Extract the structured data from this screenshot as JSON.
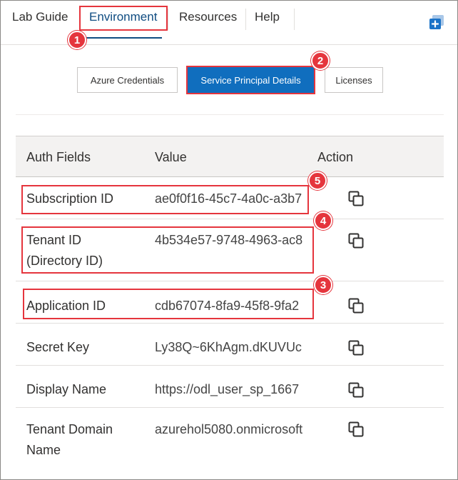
{
  "nav": {
    "tabs": [
      {
        "label": "Lab Guide"
      },
      {
        "label": "Environment"
      },
      {
        "label": "Resources"
      },
      {
        "label": "Help"
      }
    ],
    "corner_icon": "add-window-icon"
  },
  "subtabs": [
    {
      "label": "Azure Credentials"
    },
    {
      "label": "Service Principal Details"
    },
    {
      "label": "Licenses"
    }
  ],
  "table": {
    "headers": [
      "Auth Fields",
      "Value",
      "Action"
    ],
    "rows": [
      {
        "field": "Subscription ID",
        "value": "ae0f0f16-45c7-4a0c-a3b7",
        "action_icon": "copy-icon"
      },
      {
        "field": "Tenant ID (Directory ID)",
        "value": "4b534e57-9748-4963-ac8",
        "action_icon": "copy-icon"
      },
      {
        "field": "Application ID",
        "value": "cdb67074-8fa9-45f8-9fa2",
        "action_icon": "copy-icon"
      },
      {
        "field": "Secret Key",
        "value": "Ly38Q~6KhAgm.dKUVUc",
        "action_icon": "copy-icon"
      },
      {
        "field": "Display Name",
        "value": "https://odl_user_sp_1667",
        "action_icon": "copy-icon"
      },
      {
        "field": "Tenant Domain Name",
        "value": "azurehol5080.onmicrosoft",
        "action_icon": "copy-icon"
      }
    ]
  },
  "badges": [
    "1",
    "2",
    "3",
    "4",
    "5"
  ],
  "colors": {
    "accent": "#106ebe",
    "highlight": "#e5353d",
    "active_tab": "#0f4c81"
  }
}
